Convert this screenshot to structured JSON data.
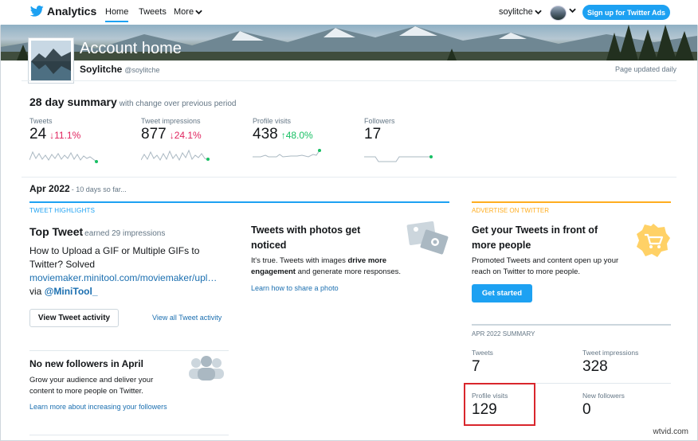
{
  "nav": {
    "brand": "Analytics",
    "links": [
      "Home",
      "Tweets",
      "More"
    ],
    "username": "soylitche",
    "ads_button": "Sign up for Twitter Ads"
  },
  "header": {
    "title": "Account home",
    "name": "Soylitche",
    "handle": "@soylitche",
    "updated": "Page updated daily"
  },
  "summary": {
    "title": "28 day summary",
    "subtitle": "with change over previous period",
    "stats": [
      {
        "label": "Tweets",
        "value": "24",
        "change": "11.1%",
        "direction": "down"
      },
      {
        "label": "Tweet impressions",
        "value": "877",
        "change": "24.1%",
        "direction": "down"
      },
      {
        "label": "Profile visits",
        "value": "438",
        "change": "48.0%",
        "direction": "up"
      },
      {
        "label": "Followers",
        "value": "17",
        "change": "",
        "direction": "none"
      }
    ]
  },
  "month": {
    "title": "Apr 2022",
    "sub": "- 10 days so far..."
  },
  "highlights": {
    "label": "TWEET HIGHLIGHTS",
    "top_tweet_title": "Top Tweet",
    "top_tweet_earned": "earned 29 impressions",
    "tweet_text": "How to Upload a GIF or Multiple GIFs to Twitter? Solved",
    "tweet_link": "moviemaker.minitool.com/moviemaker/upl…",
    "tweet_via": "via",
    "tweet_mention": "@MiniTool_",
    "view_activity": "View Tweet activity",
    "view_all": "View all Tweet activity",
    "followers_title": "No new followers in April",
    "followers_text": "Grow your audience and deliver your content to more people on Twitter.",
    "followers_link": "Learn more about increasing your followers"
  },
  "photos": {
    "title": "Tweets with photos get noticed",
    "text_a": "It's true. Tweets with images",
    "text_bold": "drive more engagement",
    "text_b": "and generate more responses.",
    "link": "Learn how to share a photo"
  },
  "advertise": {
    "label": "ADVERTISE ON TWITTER",
    "title": "Get your Tweets in front of more people",
    "text": "Promoted Tweets and content open up your reach on Twitter to more people.",
    "button": "Get started"
  },
  "apr_summary": {
    "label": "APR 2022 SUMMARY",
    "stats": [
      {
        "label": "Tweets",
        "value": "7"
      },
      {
        "label": "Tweet impressions",
        "value": "328"
      },
      {
        "label": "Profile visits",
        "value": "129"
      },
      {
        "label": "New followers",
        "value": "0"
      }
    ]
  },
  "watermark": "wtvid.com",
  "colors": {
    "accent": "#1da1f2",
    "down": "#e0245e",
    "up": "#17bf63",
    "advertise": "#ffad1f",
    "highlight": "#d9262c"
  }
}
